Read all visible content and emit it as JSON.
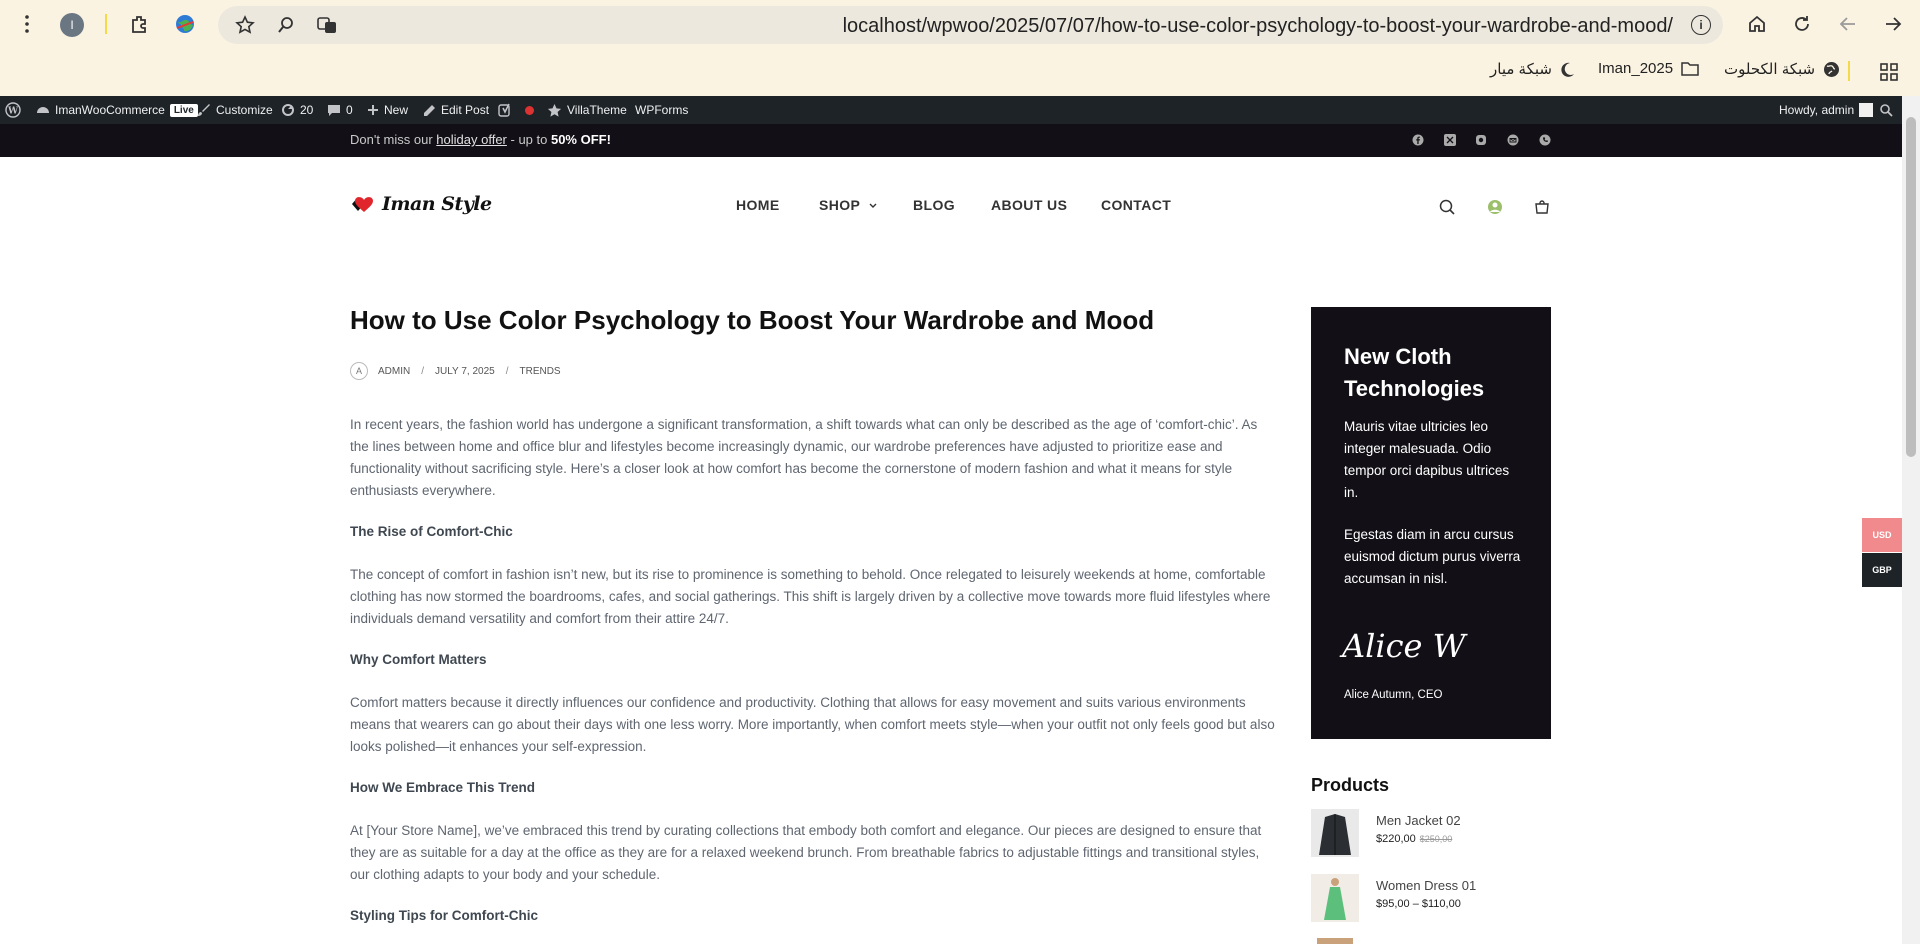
{
  "browser": {
    "url": "localhost/wpwoo/2025/07/07/how-to-use-color-psychology-to-boost-your-wardrobe-and-mood/",
    "profile_initial": "I",
    "bookmarks": [
      "شبكة الكحلوت",
      "Iman_2025",
      "شبكة ميار"
    ]
  },
  "adminbar": {
    "site": "ImanWooCommerce",
    "live": "Live",
    "customize": "Customize",
    "updates": "20",
    "comments": "0",
    "new": "New",
    "edit_post": "Edit Post",
    "villatheme": "VillaTheme",
    "wpforms": "WPForms",
    "howdy": "Howdy, admin"
  },
  "promo": {
    "prefix": "Don't miss our ",
    "link": "holiday offer",
    "middle": " - up to ",
    "highlight": "50% OFF!"
  },
  "site": {
    "logo": "Iman Style",
    "nav": [
      "HOME",
      "SHOP",
      "BLOG",
      "ABOUT US",
      "CONTACT"
    ]
  },
  "post": {
    "title": "How to Use Color Psychology to Boost Your Wardrobe and Mood",
    "author": "ADMIN",
    "date": "JULY 7, 2025",
    "category": "TRENDS",
    "avatar_alt": "A",
    "p1": "In recent years, the fashion world has undergone a significant transformation, a shift towards what can only be described as the age of ‘comfort-chic’. As the lines between home and office blur and lifestyles become increasingly dynamic, our wardrobe preferences have adjusted to prioritize ease and functionality without sacrificing style. Here’s a closer look at how comfort has become the cornerstone of modern fashion and what it means for style enthusiasts everywhere.",
    "h1": "The Rise of Comfort-Chic",
    "p2": "The concept of comfort in fashion isn’t new, but its rise to prominence is something to behold. Once relegated to leisurely weekends at home, comfortable clothing has now stormed the boardrooms, cafes, and social gatherings. This shift is largely driven by a collective move towards more fluid lifestyles where individuals demand versatility and comfort from their attire 24/7.",
    "h2": "Why Comfort Matters",
    "p3": "Comfort matters because it directly influences our confidence and productivity. Clothing that allows for easy movement and suits various environments means that wearers can go about their days with one less worry. More importantly, when comfort meets style—when your outfit not only feels good but also looks polished—it enhances your self-expression.",
    "h3": "How We Embrace This Trend",
    "p4": "At [Your Store Name], we’ve embraced this trend by curating collections that embody both comfort and elegance. Our pieces are designed to ensure that they are as suitable for a day at the office as they are for a relaxed weekend brunch. From breathable fabrics to adjustable fittings and transitional styles, our clothing adapts to your body and your schedule.",
    "h4": "Styling Tips for Comfort-Chic"
  },
  "sidebar": {
    "promo_title": "New Cloth Technologies",
    "promo_p1": "Mauris vitae ultricies leo integer malesuada. Odio tempor orci dapibus ultrices in.",
    "promo_p2": "Egestas diam in arcu cursus euismod dictum purus viverra accumsan in nisl.",
    "signature": "Alice W",
    "signer": "Alice Autumn, CEO",
    "products_heading": "Products",
    "products": [
      {
        "name": "Men Jacket 02",
        "price": "$220,00",
        "old_price": "$250,00"
      },
      {
        "name": "Women Dress 01",
        "price": "$95,00 – $110,00",
        "old_price": ""
      }
    ]
  },
  "currency": {
    "usd": "USD",
    "gbp": "GBP"
  },
  "colors": {
    "usd_bg": "#f08a8d",
    "gbp_bg": "#1d2327",
    "dark_bg": "#121016"
  }
}
